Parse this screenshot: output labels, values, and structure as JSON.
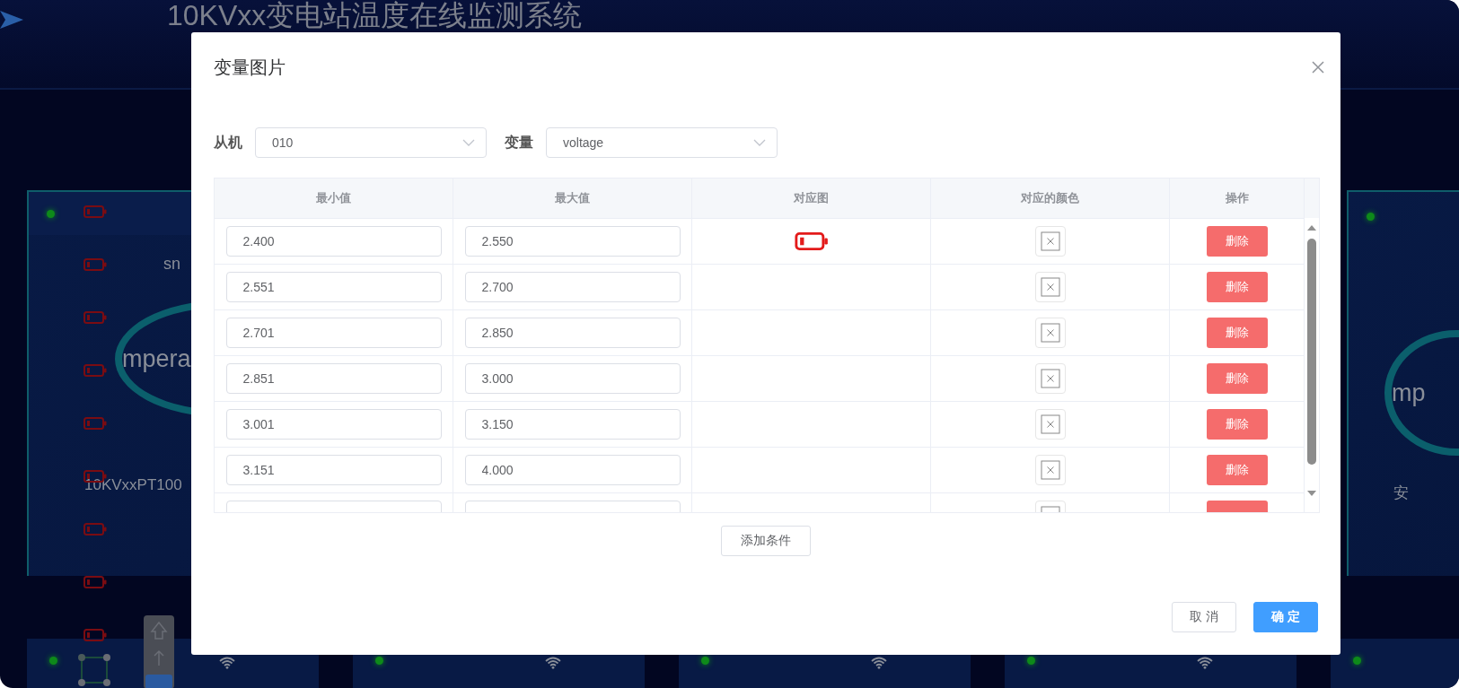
{
  "header": {
    "title": "10KVxx变电站温度在线监测系统"
  },
  "background": {
    "left_card": {
      "label": "sn",
      "gauge_text": "mpera",
      "device": "10KVxxPT100"
    },
    "right_card": {
      "gauge_text": "mp",
      "device": "安"
    }
  },
  "dialog": {
    "title": "变量图片",
    "filters": [
      {
        "label": "从机",
        "value": "010"
      },
      {
        "label": "变量",
        "value": "voltage"
      }
    ],
    "table": {
      "columns": [
        "最小值",
        "最大值",
        "对应图",
        "对应的颜色",
        "操作"
      ],
      "rows": [
        {
          "min": "2.400",
          "max": "2.550",
          "has_image": true,
          "action": "删除"
        },
        {
          "min": "2.551",
          "max": "2.700",
          "has_image": false,
          "action": "删除"
        },
        {
          "min": "2.701",
          "max": "2.850",
          "has_image": false,
          "action": "删除"
        },
        {
          "min": "2.851",
          "max": "3.000",
          "has_image": false,
          "action": "删除"
        },
        {
          "min": "3.001",
          "max": "3.150",
          "has_image": false,
          "action": "删除"
        },
        {
          "min": "3.151",
          "max": "4.000",
          "has_image": false,
          "action": "删除"
        },
        {
          "has_image": false
        }
      ]
    },
    "add_button": "添加条件",
    "buttons": [
      {
        "label": "取 消",
        "kind": "secondary"
      },
      {
        "label": "确 定",
        "kind": "primary"
      }
    ]
  }
}
